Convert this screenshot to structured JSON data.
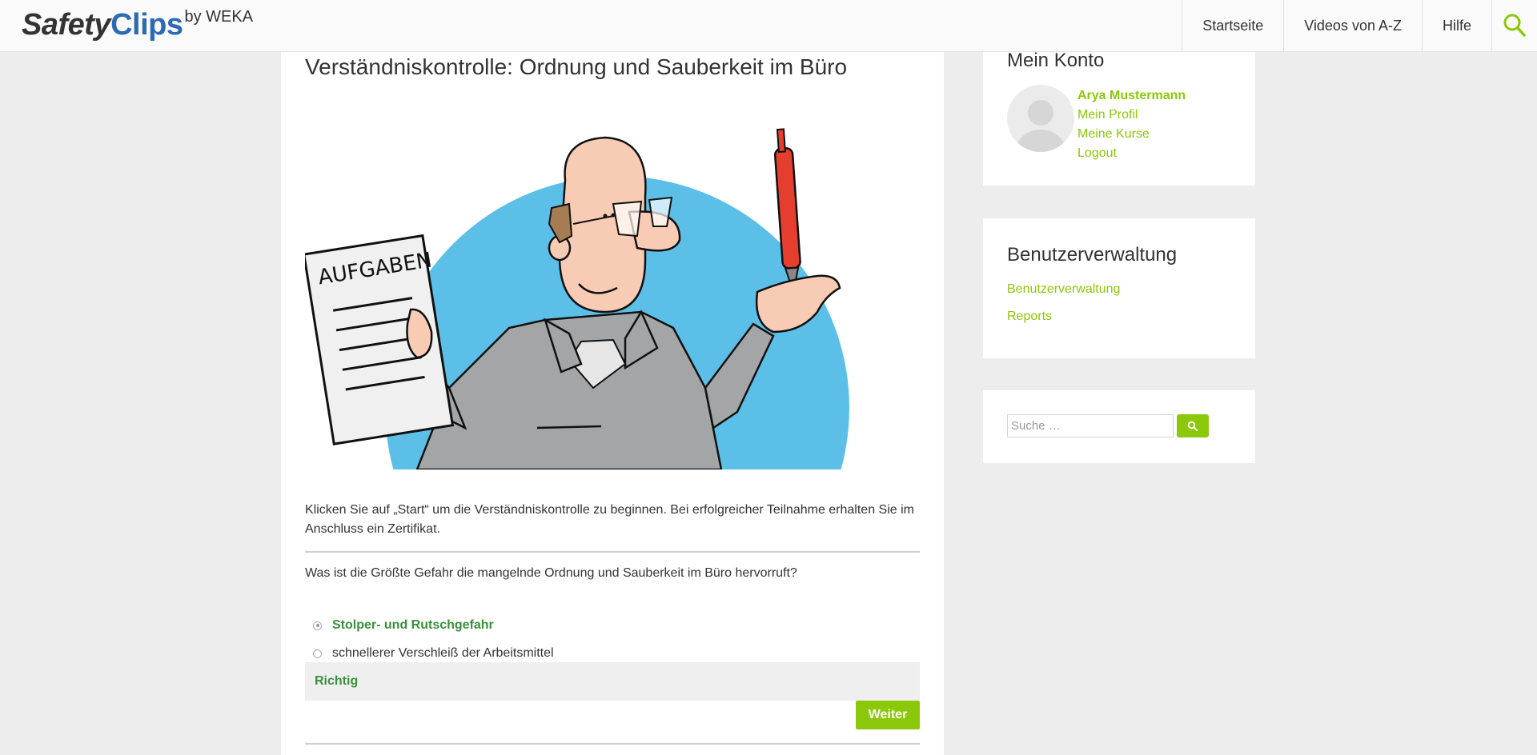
{
  "header": {
    "logo": {
      "part1": "Safety",
      "part2": "Clips",
      "by": "by WEKA"
    },
    "nav": {
      "home": "Startseite",
      "videos": "Videos von A-Z",
      "help": "Hilfe"
    },
    "search_icon": "search-icon"
  },
  "main": {
    "title": "Verständniskontrolle: Ordnung und Sauberkeit im Büro",
    "illustration": {
      "icon": "cartoon-man-with-task-list-and-pen",
      "paper_text": "AUFGABEN"
    },
    "intro": "Klicken Sie auf „Start“ um die Verständniskontrolle zu beginnen. Bei erfolgreicher Teilnahme erhalten Sie im Anschluss ein Zertifikat.",
    "question": "Was ist die Größte Gefahr die mangelnde Ordnung und Sauberkeit im Büro hervorruft?",
    "answers": [
      {
        "label": "Stolper- und Rutschgefahr",
        "selected": true,
        "correct": true
      },
      {
        "label": "schnellerer Verschleiß der Arbeitsmittel",
        "selected": false,
        "correct": false
      }
    ],
    "feedback": "Richtig",
    "next_button": "Weiter"
  },
  "sidebar": {
    "konto": {
      "title": "Mein Konto",
      "name": "Arya Mustermann",
      "links": [
        "Mein Profil",
        "Meine Kurse",
        "Logout"
      ]
    },
    "benutzerverwaltung": {
      "title": "Benutzerverwaltung",
      "links": [
        "Benutzerverwaltung",
        "Reports"
      ]
    },
    "search": {
      "placeholder": "Suche …"
    }
  },
  "colors": {
    "accent_green": "#8cc80a",
    "correct_green": "#3b8f3b",
    "logo_blue": "#2c6bb3",
    "background": "#ededed",
    "illustration_circle": "#5cbfe8"
  }
}
